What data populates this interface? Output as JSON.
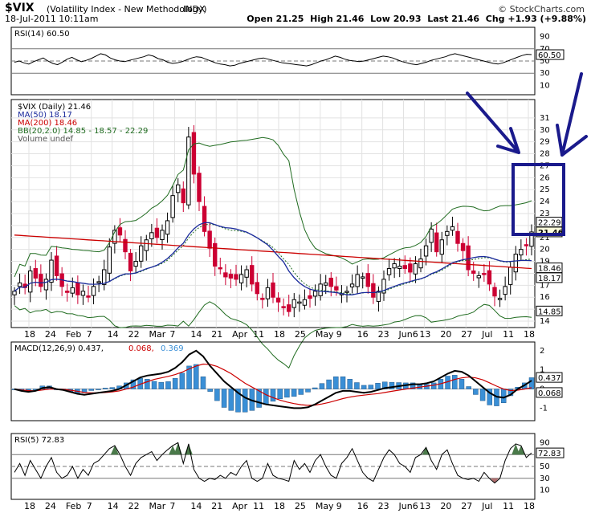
{
  "header": {
    "symbol": "$VIX",
    "name": "(Volatility Index - New Methodology)",
    "exchange": "INDX",
    "copyright": "© StockCharts.com",
    "date": "18-Jul-2011 10:11am",
    "open_label": "Open",
    "open": "21.25",
    "high_label": "High",
    "high": "21.46",
    "low_label": "Low",
    "low": "20.93",
    "last_label": "Last",
    "last": "21.46",
    "chg_label": "Chg",
    "chg": "+1.93 (+9.88%)"
  },
  "colors": {
    "up": "#000000",
    "down": "#cc0033",
    "ma50": "#1a2a9c",
    "ma200": "#cc0000",
    "bb": "#1f6b1f",
    "macd": "#000000",
    "signal": "#cc0000",
    "hist": "#3a8fd6",
    "rsi_fill": "#4a7a4a",
    "annotation": "#1a1a8c"
  },
  "chart_data": [
    {
      "type": "line",
      "panel": "RSI(14)",
      "legend": [
        "RSI(14) 60.50"
      ],
      "y_ticks": [
        "90",
        "70",
        "50",
        "30",
        "10"
      ],
      "ylim": [
        0,
        100
      ],
      "last_label": "60.50",
      "series": [
        {
          "name": "RSI(14)",
          "values": [
            48,
            50,
            47,
            45,
            49,
            52,
            55,
            50,
            46,
            44,
            48,
            53,
            56,
            52,
            49,
            51,
            54,
            58,
            62,
            60,
            55,
            52,
            50,
            49,
            51,
            53,
            55,
            57,
            60,
            58,
            54,
            52,
            48,
            46,
            47,
            49,
            52,
            55,
            57,
            56,
            53,
            50,
            47,
            45,
            44,
            42,
            43,
            46,
            48,
            50,
            52,
            54,
            55,
            53,
            51,
            49,
            47,
            46,
            45,
            44,
            43,
            42,
            44,
            47,
            50,
            52,
            55,
            58,
            56,
            53,
            51,
            50,
            49,
            50,
            52,
            54,
            56,
            58,
            57,
            55,
            52,
            49,
            47,
            45,
            44,
            46,
            48,
            51,
            53,
            55,
            57,
            60,
            62,
            60,
            58,
            56,
            54,
            52,
            50,
            48,
            46,
            45,
            47,
            50,
            53,
            56,
            59,
            61,
            60.5
          ]
        }
      ]
    },
    {
      "type": "candlestick",
      "panel": "$VIX (Daily)",
      "legend": [
        "$VIX (Daily) 21.46",
        "MA(50) 18.17",
        "MA(200) 18.46",
        "BB(20,2.0) 14.85 - 18.57 - 22.29",
        "Volume undef"
      ],
      "y_ticks": [
        "31",
        "30",
        "29",
        "28",
        "27",
        "26",
        "25",
        "24",
        "23",
        "22",
        "21",
        "20",
        "19",
        "18",
        "17",
        "16",
        "15",
        "14"
      ],
      "ylim": [
        14,
        32
      ],
      "right_labels": [
        "22.29",
        "21.46",
        "18.46",
        "18.17",
        "14.85"
      ],
      "x_ticks": [
        "18",
        "24",
        "Feb",
        "7",
        "14",
        "22",
        "Mar",
        "7",
        "14",
        "21",
        "Apr",
        "11",
        "18",
        "25",
        "May",
        "9",
        "16",
        "23",
        "Jun6",
        "13",
        "20",
        "27",
        "Jul",
        "11",
        "18"
      ],
      "close": [
        16.5,
        17.2,
        16.8,
        18.2,
        17.6,
        16.9,
        17.5,
        19.1,
        17.8,
        16.9,
        16.4,
        16.8,
        16.2,
        16.5,
        16.0,
        16.9,
        17.3,
        18.3,
        20.2,
        21.6,
        21.2,
        19.8,
        18.2,
        19.0,
        20.3,
        20.8,
        21.4,
        21.0,
        21.6,
        22.4,
        24.5,
        25.4,
        23.9,
        29.4,
        26.3,
        24.0,
        21.5,
        20.1,
        18.6,
        18.4,
        17.7,
        17.6,
        17.5,
        17.9,
        18.3,
        17.1,
        16.3,
        15.9,
        16.8,
        16.0,
        15.6,
        15.2,
        14.8,
        15.8,
        15.6,
        15.8,
        15.9,
        16.5,
        17.1,
        17.2,
        16.9,
        16.6,
        16.3,
        16.5,
        17.1,
        17.9,
        17.7,
        16.9,
        16.0,
        16.5,
        17.5,
        18.4,
        18.8,
        18.6,
        18.4,
        18.1,
        18.8,
        19.2,
        20.3,
        21.7,
        19.8,
        20.8,
        21.5,
        21.9,
        20.5,
        19.9,
        18.3,
        18.0,
        17.8,
        17.9,
        17.1,
        16.1,
        15.9,
        16.9,
        18.5,
        19.6,
        20.0,
        20.3,
        21.46
      ]
    },
    {
      "type": "line",
      "panel": "MACD(12,26,9)",
      "legend": [
        "MACD(12,26,9) 0.437,",
        "0.068,",
        "0.369"
      ],
      "y_ticks": [
        "2",
        "1",
        "0",
        "-1"
      ],
      "ylim": [
        -1.4,
        2.2
      ],
      "right_labels": [
        "0.437",
        "0.068"
      ],
      "series": [
        {
          "name": "MACD",
          "values": [
            0.0,
            -0.1,
            -0.15,
            -0.1,
            0.05,
            0.1,
            0.0,
            -0.05,
            -0.15,
            -0.25,
            -0.3,
            -0.25,
            -0.2,
            -0.15,
            -0.1,
            0.0,
            0.2,
            0.4,
            0.6,
            0.7,
            0.75,
            0.8,
            0.9,
            1.1,
            1.4,
            1.8,
            2.0,
            1.7,
            1.2,
            0.8,
            0.4,
            0.1,
            -0.2,
            -0.45,
            -0.6,
            -0.7,
            -0.8,
            -0.85,
            -0.9,
            -0.95,
            -1.0,
            -1.0,
            -0.95,
            -0.8,
            -0.6,
            -0.4,
            -0.2,
            -0.1,
            -0.1,
            -0.15,
            -0.2,
            -0.15,
            -0.05,
            0.05,
            0.1,
            0.15,
            0.2,
            0.25,
            0.25,
            0.3,
            0.4,
            0.6,
            0.8,
            0.95,
            0.9,
            0.7,
            0.4,
            0.1,
            -0.2,
            -0.4,
            -0.45,
            -0.3,
            0.0,
            0.2,
            0.437
          ]
        },
        {
          "name": "Signal",
          "values": [
            0.0,
            -0.05,
            -0.08,
            -0.1,
            -0.05,
            0.0,
            0.0,
            -0.02,
            -0.06,
            -0.12,
            -0.18,
            -0.2,
            -0.2,
            -0.18,
            -0.15,
            -0.1,
            0.0,
            0.1,
            0.25,
            0.38,
            0.5,
            0.58,
            0.66,
            0.75,
            0.88,
            1.05,
            1.2,
            1.3,
            1.28,
            1.18,
            1.0,
            0.8,
            0.55,
            0.3,
            0.1,
            -0.1,
            -0.3,
            -0.45,
            -0.58,
            -0.68,
            -0.76,
            -0.82,
            -0.85,
            -0.84,
            -0.78,
            -0.7,
            -0.6,
            -0.5,
            -0.42,
            -0.36,
            -0.32,
            -0.28,
            -0.24,
            -0.18,
            -0.12,
            -0.06,
            0.0,
            0.05,
            0.1,
            0.15,
            0.2,
            0.28,
            0.38,
            0.5,
            0.58,
            0.62,
            0.58,
            0.48,
            0.32,
            0.15,
            0.0,
            -0.08,
            -0.06,
            0.0,
            0.068
          ]
        }
      ]
    },
    {
      "type": "line",
      "panel": "RSI(5)",
      "legend": [
        "RSI(5) 72.83"
      ],
      "y_ticks": [
        "90",
        "70",
        "50",
        "30",
        "10"
      ],
      "ylim": [
        0,
        100
      ],
      "last_label": "72.83",
      "x_ticks": [
        "18",
        "24",
        "Feb",
        "7",
        "14",
        "22",
        "Mar",
        "7",
        "14",
        "21",
        "Apr",
        "11",
        "18",
        "25",
        "May",
        "9",
        "16",
        "23",
        "Jun6",
        "13",
        "20",
        "27",
        "Jul",
        "11",
        "18"
      ],
      "series": [
        {
          "name": "RSI(5)",
          "values": [
            40,
            55,
            35,
            60,
            45,
            30,
            50,
            65,
            40,
            30,
            35,
            50,
            30,
            45,
            35,
            55,
            60,
            70,
            80,
            85,
            70,
            50,
            35,
            55,
            65,
            70,
            75,
            60,
            70,
            78,
            85,
            90,
            55,
            88,
            45,
            30,
            25,
            30,
            28,
            35,
            30,
            40,
            35,
            50,
            60,
            30,
            25,
            30,
            55,
            35,
            30,
            28,
            25,
            60,
            45,
            55,
            40,
            60,
            70,
            50,
            35,
            30,
            55,
            65,
            80,
            60,
            40,
            30,
            25,
            45,
            65,
            78,
            70,
            55,
            50,
            40,
            65,
            70,
            82,
            60,
            45,
            70,
            78,
            55,
            35,
            30,
            28,
            30,
            25,
            40,
            30,
            22,
            30,
            60,
            80,
            88,
            85,
            65,
            72.83
          ]
        }
      ]
    }
  ]
}
